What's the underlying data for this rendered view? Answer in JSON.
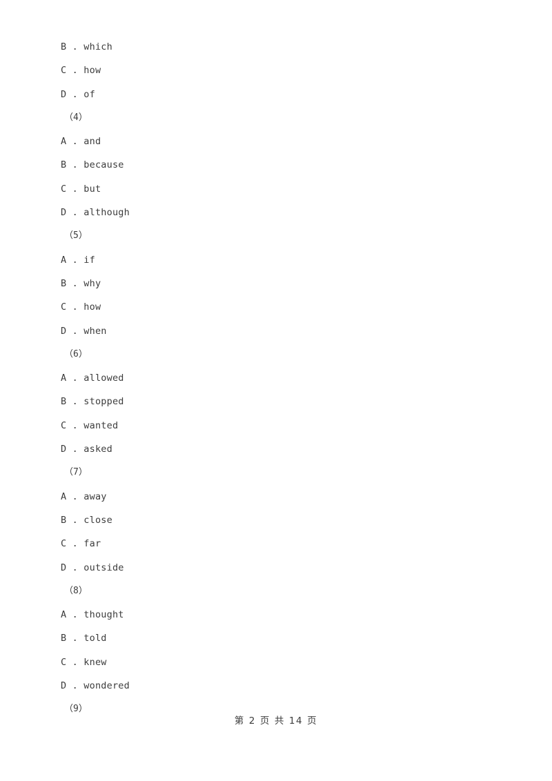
{
  "document": {
    "background_color": "#ffffff",
    "text_color": "#3c3c3c"
  },
  "blocks": [
    {
      "type": "option",
      "text": "B . which"
    },
    {
      "type": "option",
      "text": "C . how"
    },
    {
      "type": "option",
      "text": "D . of"
    },
    {
      "type": "qnum",
      "text": "（4）"
    },
    {
      "type": "option",
      "text": "A . and"
    },
    {
      "type": "option",
      "text": "B . because"
    },
    {
      "type": "option",
      "text": "C . but"
    },
    {
      "type": "option",
      "text": "D . although"
    },
    {
      "type": "qnum",
      "text": "（5）"
    },
    {
      "type": "option",
      "text": "A . if"
    },
    {
      "type": "option",
      "text": "B . why"
    },
    {
      "type": "option",
      "text": "C . how"
    },
    {
      "type": "option",
      "text": "D . when"
    },
    {
      "type": "qnum",
      "text": "（6）"
    },
    {
      "type": "option",
      "text": "A . allowed"
    },
    {
      "type": "option",
      "text": "B . stopped"
    },
    {
      "type": "option",
      "text": "C . wanted"
    },
    {
      "type": "option",
      "text": "D . asked"
    },
    {
      "type": "qnum",
      "text": "（7）"
    },
    {
      "type": "option",
      "text": "A . away"
    },
    {
      "type": "option",
      "text": "B . close"
    },
    {
      "type": "option",
      "text": "C . far"
    },
    {
      "type": "option",
      "text": "D . outside"
    },
    {
      "type": "qnum",
      "text": "（8）"
    },
    {
      "type": "option",
      "text": "A . thought"
    },
    {
      "type": "option",
      "text": "B . told"
    },
    {
      "type": "option",
      "text": "C . knew"
    },
    {
      "type": "option",
      "text": "D . wondered"
    },
    {
      "type": "qnum",
      "text": "（9）"
    }
  ],
  "footer": {
    "page_label": "第 2 页 共 14 页",
    "current_page": 2,
    "total_pages": 14
  }
}
